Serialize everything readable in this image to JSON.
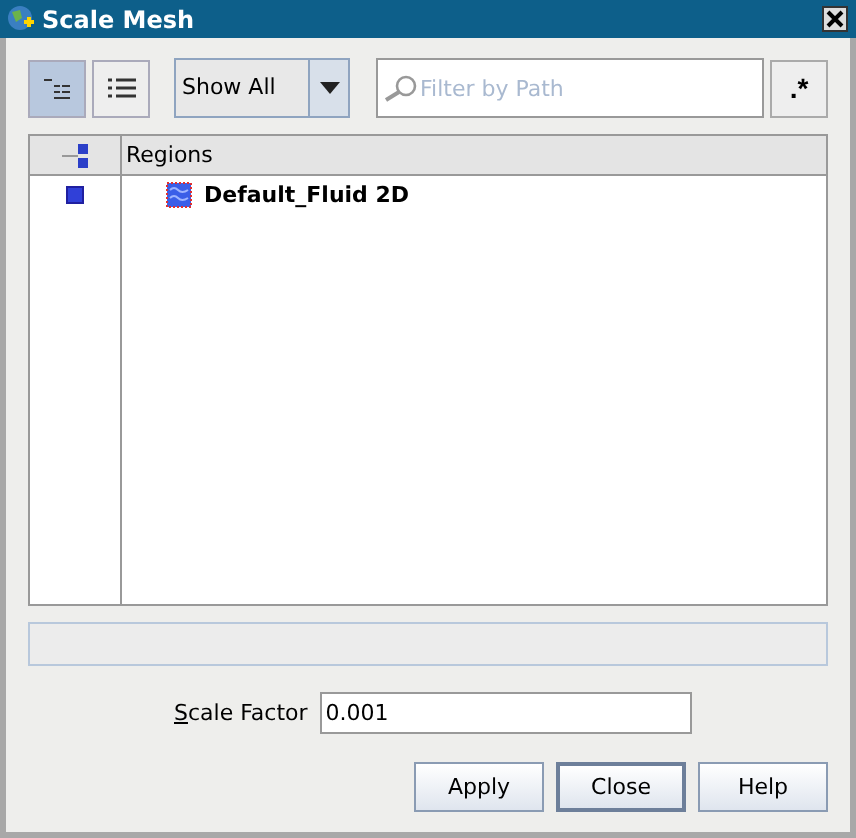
{
  "window": {
    "title": "Scale Mesh"
  },
  "view_buttons": [
    {
      "kind": "tree",
      "selected": true
    },
    {
      "kind": "list",
      "selected": false
    }
  ],
  "filter_dropdown": {
    "value": "Show All"
  },
  "path_filter": {
    "placeholder": "Filter by Path",
    "regex_button": ".*"
  },
  "table": {
    "columns": [
      "Regions"
    ],
    "rows": [
      {
        "label": "Default_Fluid 2D",
        "checked": true
      }
    ]
  },
  "scale_factor": {
    "label": "Scale Factor",
    "value": "0.001"
  },
  "buttons": [
    {
      "label": "Apply",
      "default": false
    },
    {
      "label": "Close",
      "default": true
    },
    {
      "label": "Help",
      "default": false
    }
  ]
}
